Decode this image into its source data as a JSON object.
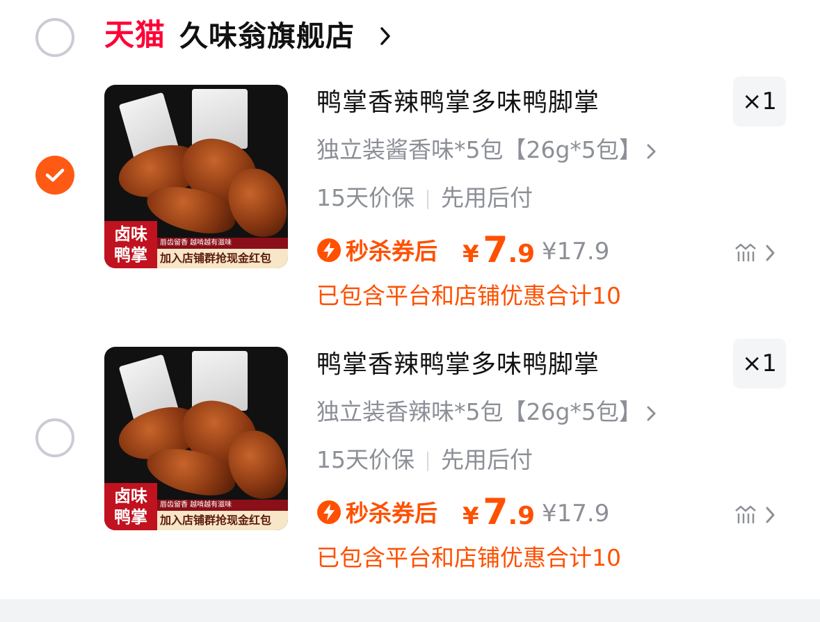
{
  "store": {
    "platform_logo": "天猫",
    "name": "久味翁旗舰店"
  },
  "products": [
    {
      "selected": true,
      "thumb_badge": "卤味\n鸭掌",
      "thumb_strip_top": "唇齿留香 越啃越有滋味",
      "thumb_strip_bottom": "加入店铺群抢现金红包",
      "title": "鸭掌香辣鸭掌多味鸭脚掌",
      "quantity": "×1",
      "spec": "独立装酱香味*5包【26g*5包】",
      "guarantee_1": "15天价保",
      "guarantee_2": "先用后付",
      "promo_label": "秒杀券后",
      "currency": "¥",
      "price_int": "7",
      "price_dec": ".9",
      "original_price": "¥17.9",
      "discount_note": "已包含平台和店铺优惠合计10"
    },
    {
      "selected": false,
      "thumb_badge": "卤味\n鸭掌",
      "thumb_strip_top": "唇齿留香 越啃越有滋味",
      "thumb_strip_bottom": "加入店铺群抢现金红包",
      "title": "鸭掌香辣鸭掌多味鸭脚掌",
      "quantity": "×1",
      "spec": "独立装香辣味*5包【26g*5包】",
      "guarantee_1": "15天价保",
      "guarantee_2": "先用后付",
      "promo_label": "秒杀券后",
      "currency": "¥",
      "price_int": "7",
      "price_dec": ".9",
      "original_price": "¥17.9",
      "discount_note": "已包含平台和店铺优惠合计10"
    }
  ],
  "colors": {
    "accent": "#ff5000",
    "tmall": "#ff0036",
    "muted_text": "#8c8f96"
  }
}
